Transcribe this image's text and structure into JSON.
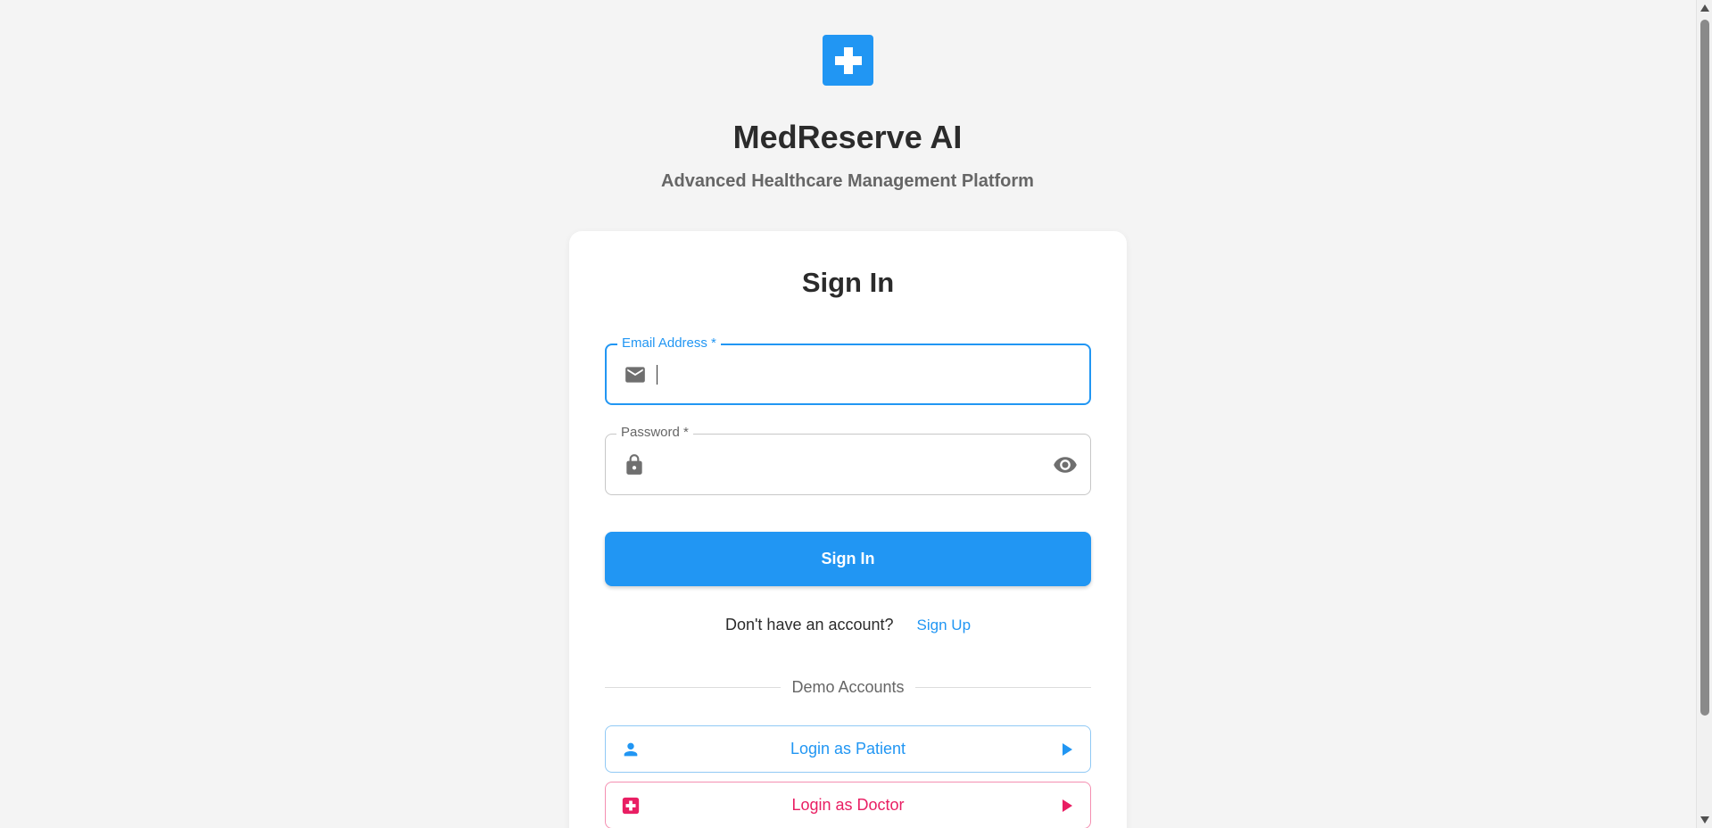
{
  "header": {
    "logo_icon": "medical-cross-icon",
    "title": "MedReserve AI",
    "subtitle": "Advanced Healthcare Management Platform"
  },
  "signin_card": {
    "title": "Sign In",
    "email_field": {
      "label": "Email Address *",
      "value": "",
      "icon": "mail-icon",
      "focused": true
    },
    "password_field": {
      "label": "Password *",
      "value": "",
      "icon": "lock-icon",
      "toggle_icon": "eye-icon"
    },
    "submit_label": "Sign In",
    "signup_prompt": "Don't have an account?",
    "signup_link": "Sign Up",
    "demo_divider": "Demo Accounts",
    "demo_buttons": [
      {
        "label": "Login as Patient",
        "icon": "person-icon",
        "color": "#2196f3"
      },
      {
        "label": "Login as Doctor",
        "icon": "medical-cross-icon",
        "color": "#e91e63"
      }
    ]
  },
  "colors": {
    "primary": "#2196f3",
    "doctor_accent": "#e91e63",
    "background": "#f4f4f4"
  }
}
